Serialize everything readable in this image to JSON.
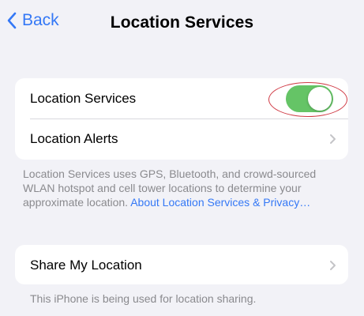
{
  "nav": {
    "back_label": "Back",
    "title": "Location Services"
  },
  "group1": {
    "location_services_label": "Location Services",
    "location_services_enabled": true,
    "location_alerts_label": "Location Alerts"
  },
  "footnote1": {
    "text": "Location Services uses GPS, Bluetooth, and crowd-sourced WLAN hotspot and cell tower locations to determine your approximate location. ",
    "link": "About Location Services & Privacy…"
  },
  "group2": {
    "share_my_location_label": "Share My Location"
  },
  "footnote2": {
    "text": "This iPhone is being used for location sharing."
  },
  "colors": {
    "accent": "#3478f6",
    "toggle_on": "#65c466",
    "background": "#f2f2f7",
    "highlight_annotation": "#d03a45"
  },
  "icons": {
    "back": "chevron-left-icon",
    "row_disclosure": "chevron-right-icon"
  }
}
